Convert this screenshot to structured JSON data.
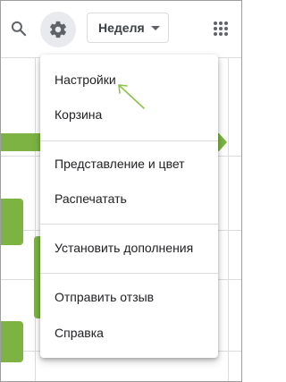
{
  "header": {
    "search_icon": "search-icon",
    "settings_icon": "gear-icon",
    "view_select": {
      "value": "Неделя"
    },
    "apps_icon": "apps-grid-icon"
  },
  "menu": {
    "items": [
      {
        "label": "Настройки"
      },
      {
        "label": "Корзина"
      },
      {
        "label": "Представление и цвет"
      },
      {
        "label": "Распечатать"
      },
      {
        "label": "Установить дополнения"
      },
      {
        "label": "Отправить отзыв"
      },
      {
        "label": "Справка"
      }
    ]
  },
  "colors": {
    "event_green": "#7cb342",
    "annotation_arrow": "#8bc34a"
  }
}
